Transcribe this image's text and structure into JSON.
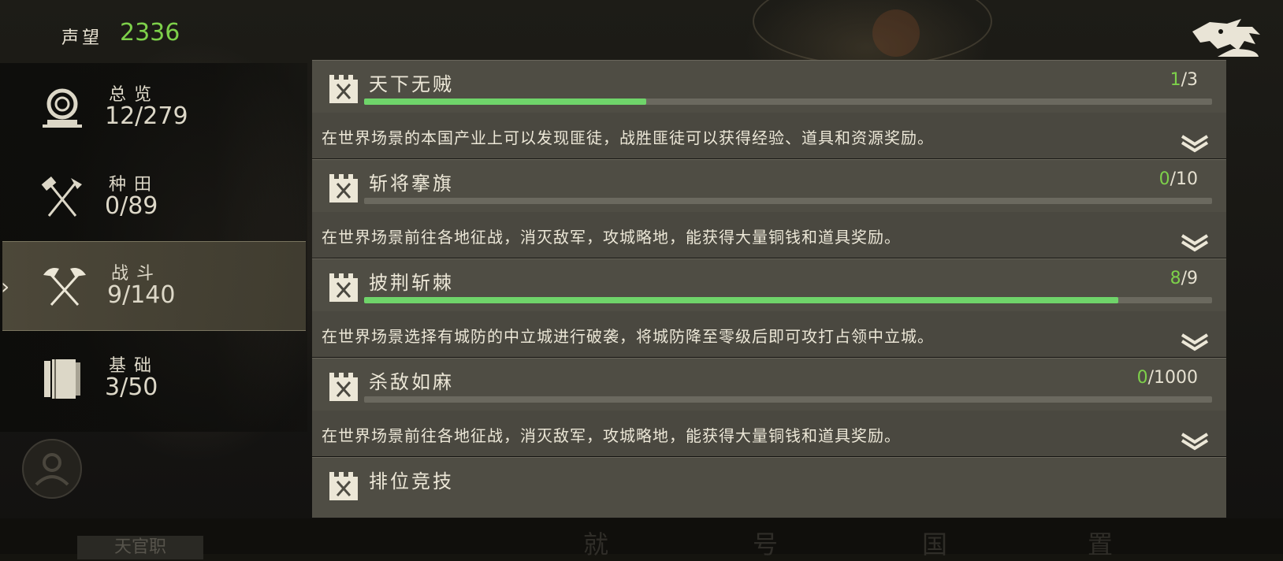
{
  "header": {
    "reputation_label": "声望",
    "reputation_value": "2336"
  },
  "sidebar": {
    "items": [
      {
        "name": "总览",
        "count": "12/279",
        "icon": "overview-ring-icon",
        "active": false
      },
      {
        "name": "种田",
        "count": "0/89",
        "icon": "farming-tools-icon",
        "active": false
      },
      {
        "name": "战斗",
        "count": "9/140",
        "icon": "crossed-axes-icon",
        "active": true
      },
      {
        "name": "基础",
        "count": "3/50",
        "icon": "book-icon",
        "active": false
      }
    ]
  },
  "quests": [
    {
      "title": "天下无贼",
      "current": "1",
      "total": "/3",
      "progress": 0.333,
      "desc": "在世界场景的本国产业上可以发现匪徒，战胜匪徒可以获得经验、道具和资源奖励。"
    },
    {
      "title": "斩将搴旗",
      "current": "0",
      "total": "/10",
      "progress": 0.0,
      "desc": "在世界场景前往各地征战，消灭敌军，攻城略地，能获得大量铜钱和道具奖励。"
    },
    {
      "title": "披荆斩棘",
      "current": "8",
      "total": "/9",
      "progress": 0.889,
      "desc": "在世界场景选择有城防的中立城进行破袭，将城防降至零级后即可攻打占领中立城。"
    },
    {
      "title": "杀敌如麻",
      "current": "0",
      "total": "/1000",
      "progress": 0.0,
      "desc": "在世界场景前往各地征战，消灭敌军，攻城略地，能获得大量铜钱和道具奖励。"
    },
    {
      "title": "排位竞技"
    }
  ],
  "background_labels": [
    "就",
    "号",
    "国",
    "置"
  ],
  "bottom_tab": "天官职",
  "colors": {
    "accent_green": "#7dd04a",
    "progress_fill": "#6fd46a",
    "card_bg": "#4a4840"
  }
}
